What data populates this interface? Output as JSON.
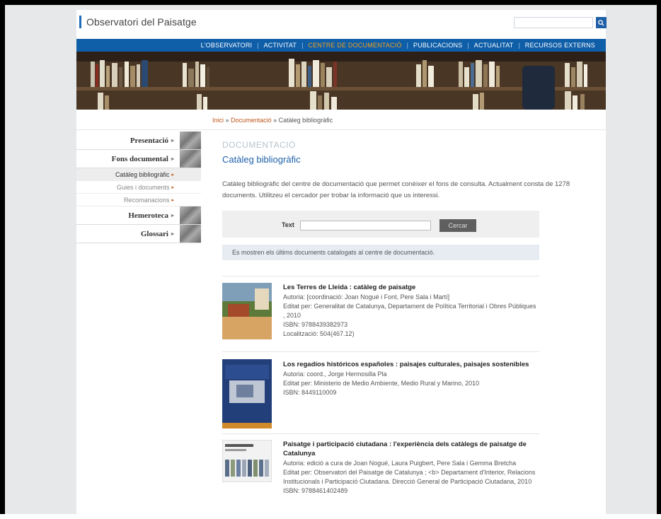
{
  "header": {
    "logo_text": "Observatori del Paisatge",
    "search_icon": "magnifier-icon"
  },
  "nav": [
    "L'OBSERVATORI",
    "ACTIVITAT",
    "CENTRE DE DOCUMENTACIÓ",
    "PUBLICACIONS",
    "ACTUALITAT",
    "RECURSOS EXTERNS"
  ],
  "nav_active_index": 2,
  "breadcrumb": {
    "home": "Inici",
    "sep1": "»",
    "doc": "Documentació",
    "sep2": "»",
    "current": "Catàleg bibliogràfic"
  },
  "sidebar": {
    "items": [
      {
        "label": "Presentació"
      },
      {
        "label": "Fons documental"
      }
    ],
    "subitems": [
      {
        "label": "Catàleg bibliogràfic",
        "selected": true
      },
      {
        "label": "Guies i documents",
        "selected": false
      },
      {
        "label": "Recomanacions",
        "selected": false
      }
    ],
    "items_after": [
      {
        "label": "Hemeroteca"
      },
      {
        "label": "Glossari"
      }
    ]
  },
  "content": {
    "section": "DOCUMENTACIÓ",
    "title": "Catàleg bibliogràfic",
    "intro": "Catàleg bibliogràfic del centre de documentació que permet conèixer el fons de consulta. Actualment consta de 1278 documents. Utilitzeu el cercador per trobar la informació que us interessi.",
    "search_label": "Text",
    "search_value": "",
    "search_button": "Cercar",
    "notice": "Es mostren els últims documents catalogats al centre de documentació."
  },
  "records": [
    {
      "title": "Les Terres de Lleida : catàleg de paisatge",
      "lines": [
        "Autoria: [coordinació: Joan Nogué i Font, Pere Sala i Martí]",
        "Editat per: Generalitat de Catalunya, Departament de Política Territorial i Obres Públiques , 2010",
        "ISBN: 9788439382973",
        "Localització: 504(467.12)"
      ]
    },
    {
      "title": "Los regadíos históricos españoles : paisajes culturales, paisajes sostenibles",
      "lines": [
        "Autoria: coord., Jorge Hermosilla Pla",
        "Editat per: Ministerio de Medio Ambiente, Medio Rural y Marino, 2010",
        "ISBN: 8449110009"
      ]
    },
    {
      "title": "Paisatge i participació ciutadana : l'experiència dels catàlegs de paisatge de Catalunya",
      "lines": [
        "Autoria: edició a cura de Joan Nogué, Laura Puigbert, Pere Sala i Gemma Bretcha",
        "Editat per: Observatori del Paisatge de Catalunya ; <b> Departament d'Interior, Relacions Institucionals i Participació Ciutadana. Direcció General de Participació Ciutadana, 2010",
        "ISBN: 9788461402489"
      ]
    }
  ],
  "colors": {
    "nav_bg": "#0f5ea8",
    "accent": "#c0571b",
    "title": "#1e5fa8"
  }
}
